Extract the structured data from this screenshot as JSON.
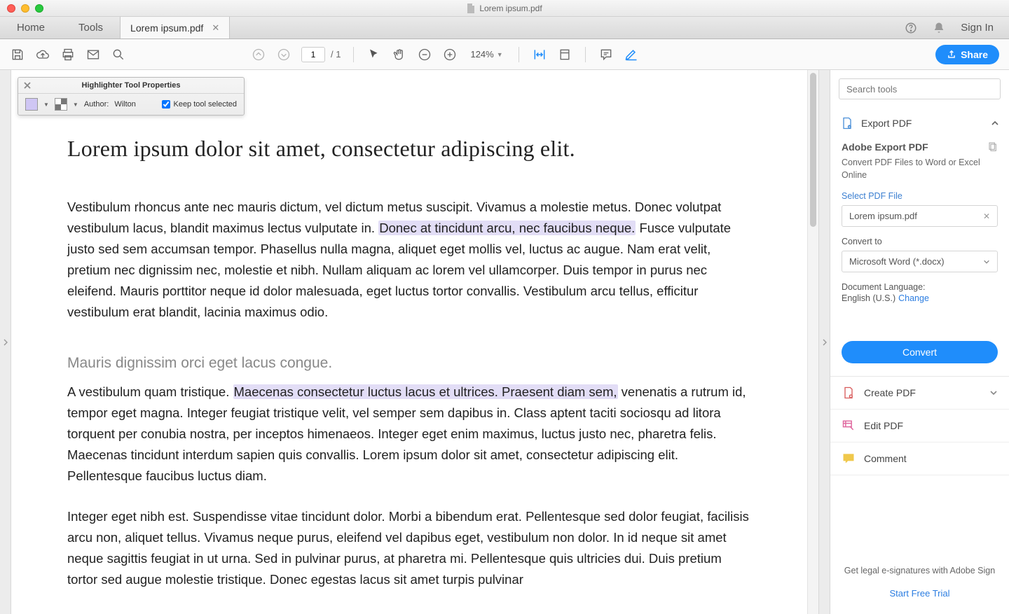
{
  "window": {
    "title": "Lorem ipsum.pdf"
  },
  "tabs": {
    "home": "Home",
    "tools": "Tools",
    "doc": "Lorem ipsum.pdf",
    "signin": "Sign In"
  },
  "toolbar": {
    "page_current": "1",
    "page_total": "/  1",
    "zoom": "124%",
    "share": "Share"
  },
  "props": {
    "title": "Highlighter Tool Properties",
    "author_label": "Author:",
    "author": "Wilton",
    "keep": "Keep tool selected"
  },
  "doc": {
    "h1": "Lorem ipsum dolor sit amet, consectetur adipiscing elit.",
    "p1a": "Vestibulum rhoncus ante nec mauris dictum, vel dictum metus suscipit. Vivamus a molestie metus. Donec volutpat vestibulum lacus, blandit maximus lectus vulputate in. ",
    "p1hl": "Donec at tincidunt arcu, nec faucibus neque.",
    "p1b": " Fusce vulputate justo sed sem accumsan tempor. Phasellus nulla magna, aliquet eget mollis vel, luctus ac augue. Nam erat velit, pretium nec dignissim nec, molestie et nibh. Nullam aliquam ac lorem vel ullamcorper. Duis tempor in purus nec eleifend. Mauris porttitor neque id dolor malesuada, eget luctus tortor convallis. Vestibulum arcu tellus, efficitur vestibulum erat blandit, lacinia maximus odio.",
    "h2": "Mauris dignissim orci eget lacus congue.",
    "p2a": "A vestibulum quam tristique. ",
    "p2hl": "Maecenas consectetur luctus lacus et ultrices. Praesent diam sem,",
    "p2b": " venenatis a rutrum id, tempor eget magna. Integer feugiat tristique velit, vel semper sem dapibus in. Class aptent taciti sociosqu ad litora torquent per conubia nostra, per inceptos himenaeos. Integer eget enim maximus, luctus justo nec, pharetra felis. Maecenas tincidunt interdum sapien quis convallis. Lorem ipsum dolor sit amet, consectetur adipiscing elit. Pellentesque faucibus luctus diam.",
    "p3": "Integer eget nibh est. Suspendisse vitae tincidunt dolor. Morbi a bibendum erat. Pellentesque sed dolor feugiat, facilisis arcu non, aliquet tellus. Vivamus neque purus, eleifend vel dapibus eget, vestibulum non dolor. In id neque sit amet neque sagittis feugiat in ut urna. Sed in pulvinar purus, at pharetra mi. Pellentesque quis ultricies dui. Duis pretium tortor sed augue molestie tristique. Donec egestas lacus sit amet turpis pulvinar"
  },
  "rpanel": {
    "search_placeholder": "Search tools",
    "export": "Export PDF",
    "export_h": "Adobe Export PDF",
    "export_sub": "Convert PDF Files to Word or Excel Online",
    "select_label": "Select PDF File",
    "selected_file": "Lorem ipsum.pdf",
    "convert_to": "Convert to",
    "convert_fmt": "Microsoft Word (*.docx)",
    "lang_label": "Document Language:",
    "lang_value": "English (U.S.)",
    "lang_change": "Change",
    "convert_btn": "Convert",
    "create": "Create PDF",
    "edit": "Edit PDF",
    "comment": "Comment",
    "footer1": "Get legal e-signatures with Adobe Sign",
    "footer2": "Start Free Trial"
  }
}
